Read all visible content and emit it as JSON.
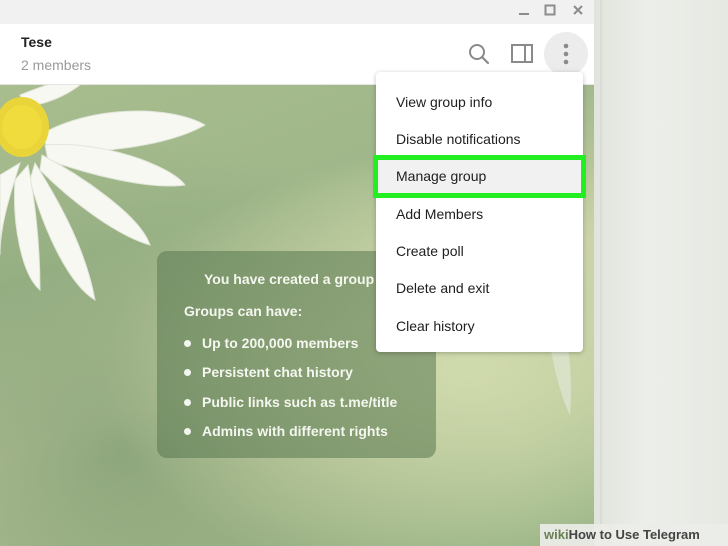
{
  "window_controls": {
    "minimize": "—",
    "maximize": "☐",
    "close": "✕"
  },
  "chat": {
    "title": "Tese",
    "subtitle": "2 members"
  },
  "header_icons": [
    "search-icon",
    "sidebar-toggle-icon",
    "more-vertical-icon"
  ],
  "info_card": {
    "title": "You have created a group",
    "subtitle": "Groups can have:",
    "items": [
      "Up to 200,000 members",
      "Persistent chat history",
      "Public links such as t.me/title",
      "Admins with different rights"
    ]
  },
  "menu": {
    "items": [
      "View group info",
      "Disable notifications",
      "Manage group",
      "Add Members",
      "Create poll",
      "Delete and exit",
      "Clear history"
    ],
    "highlighted_index": 2,
    "highlight_color": "#22ee22"
  },
  "watermark": {
    "prefix": "wiki",
    "text": "How to Use Telegram"
  }
}
